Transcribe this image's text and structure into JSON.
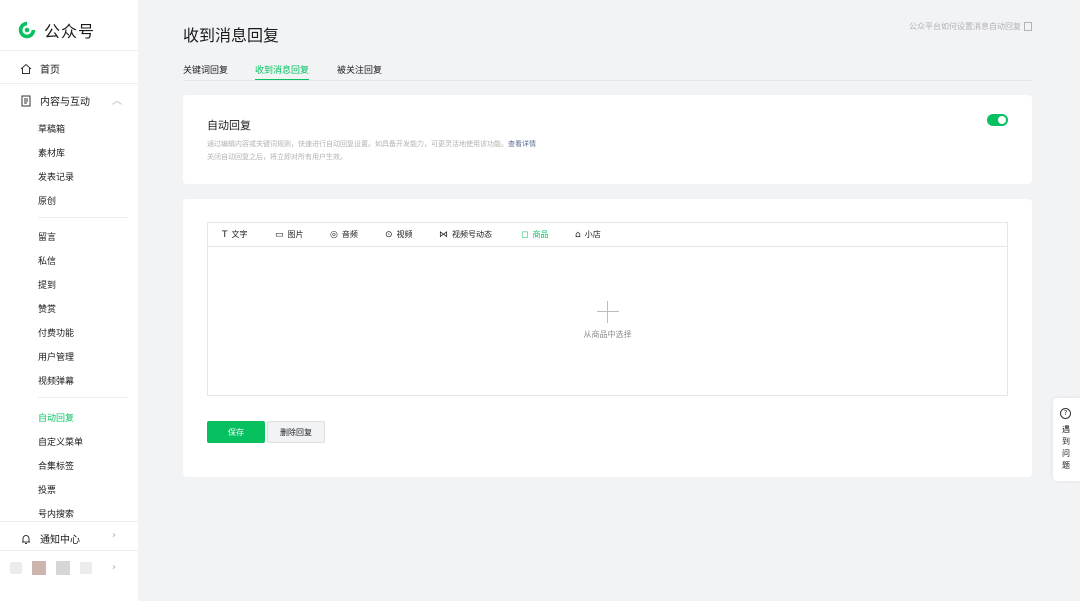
{
  "brand": {
    "name": "公众号",
    "accent": "#07c160"
  },
  "sidebar": {
    "home": {
      "label": "首页",
      "icon": "home-icon"
    },
    "content": {
      "label": "内容与互动",
      "icon": "document-icon"
    },
    "group1": [
      "草稿箱",
      "素材库",
      "发表记录",
      "原创"
    ],
    "group2": [
      "留言",
      "私信",
      "提到",
      "赞赏",
      "付费功能",
      "用户管理",
      "视频弹幕"
    ],
    "group3": [
      "自动回复",
      "自定义菜单",
      "合集标签",
      "投票",
      "号内搜索"
    ],
    "active_item": "自动回复",
    "notify": {
      "label": "通知中心",
      "icon": "bell-icon"
    }
  },
  "header": {
    "title": "收到消息回复",
    "help_link": "公众平台如何设置消息自动回复"
  },
  "tabs": [
    {
      "label": "关键词回复",
      "active": false
    },
    {
      "label": "收到消息回复",
      "active": true
    },
    {
      "label": "被关注回复",
      "active": false
    }
  ],
  "auto_reply": {
    "title": "自动回复",
    "desc_line1": "通过编辑内容或关键词规则，快速进行自动回复设置。如具备开发能力，可更灵活地使用该功能。",
    "more_link": "查看详情",
    "desc_line2": "关闭自动回复之后，将立即对所有用户生效。",
    "enabled": true
  },
  "editor": {
    "tools": [
      {
        "label": "文字",
        "icon": "text-icon",
        "glyph": "T"
      },
      {
        "label": "图片",
        "icon": "image-icon",
        "glyph": "▭"
      },
      {
        "label": "音频",
        "icon": "audio-icon",
        "glyph": "◎"
      },
      {
        "label": "视频",
        "icon": "video-icon",
        "glyph": "⊙"
      },
      {
        "label": "视频号动态",
        "icon": "channels-icon",
        "glyph": "⋈"
      },
      {
        "label": "商品",
        "icon": "shopping-bag-icon",
        "glyph": "◻"
      },
      {
        "label": "小店",
        "icon": "shop-icon",
        "glyph": "⌂"
      }
    ],
    "active_tool": "商品",
    "placeholder": "从商品中选择"
  },
  "buttons": {
    "save": "保存",
    "delete": "删除回复"
  },
  "float_help": {
    "label": "遇到问题",
    "icon": "question-icon",
    "glyph": "?"
  }
}
